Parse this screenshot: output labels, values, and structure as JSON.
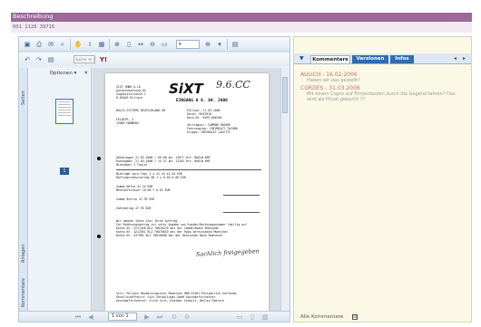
{
  "header": {
    "title": "Beschreibung",
    "id_text": "001 1120 39716"
  },
  "viewer": {
    "search_placeholder": "Suche im Web",
    "zoom": "▾",
    "sidebar": {
      "options_label": "Optionen ▾",
      "tabs": [
        "Seiten",
        "Anlagen",
        "Kommentare"
      ]
    },
    "thumbnail_page": "1",
    "status": {
      "page_box": "1 von 1"
    },
    "document": {
      "logo": "SiXT",
      "handwriting_top": "9.6.CC",
      "stamp": "EINGANG 0 6. 04. 2006",
      "address": [
        "SIXT GMBH & CO",
        "Autovermietung KG",
        "Zugspitzstrasse 1",
        "D-82049 Pullach"
      ],
      "recipient": [
        "BULIG-SYSTEMS DEUTSCHLAND GM",
        "FELDSTR. 3",
        "22085 HAMBURG"
      ],
      "meta_lines": [
        "Pullach,          21.03.2006",
        "Rechn. 9033918",
        "Rech-Nr.  9495-006706",
        "Vertragsnr:      COMMON INSURE",
        "Fahrzeugtyp:   CHEVROLET TACUMA",
        "Gruppe:          CHEVROLET LACETTI"
      ],
      "line_items": [
        "Abhoiungen  21.03.2006 / 09.00   km:  13077   Ort: BUELW KMF",
        "Rueckgabe:  21.03.2006 / 15.57   km:  13103   Ort: BUELW KMF",
        "Mietdauer    1 Tag(e)",
        "Mietlage       1pro Tag)         1 x          41.34        41.34   EUR",
        "Haftungsreduzierung  SB          1 x           0.00         0.00   EUR",
        "Summe Netto                                              41.34   EUR",
        "Mehrwertsteuer     16.00 %                                6.61   EUR",
        "Summe Brutto                                             47.95   EUR",
        "Zahlbetrag                                               47.95   EUR"
      ],
      "notes": [
        "Wir danken Ihnen fuer Ihren Auftrag.",
        "Zur Rechnungsbetrag ist unter Angabe von Kunden/Rechnungsnummer faellig auf",
        "Konto Nr.  3217440  BLZ 70020270  bei der Commerzbank Muenchen",
        "Konto Nr.  4212051  BLZ 70070010  bei der Hypo-Vereinsbank Muenchen",
        "Konto Nr.  437501   BLZ 70010080  bei der Deutschen Bank Muenchen"
      ],
      "signature": "Sachlich freigegeben",
      "footer_lines": [
        "Sitz: Pullach  Handelsregister Muenchen HRB 91501  Persoenlich haftende",
        "Gesellschafterin: Sixt Verwaltungs-GmbH  Geschaeftsfuehrer",
        "Geschaeftsfuehrer: Erich Sixt, Dietmar Schmitt, Detlev Paetsch"
      ]
    }
  },
  "comments_panel": {
    "tabs": [
      "Kommentare",
      "Versionen",
      "Infos"
    ],
    "comments": [
      {
        "author_date": "AULICH - 16.02.2006",
        "text": "Haben wir das bestellt?"
      },
      {
        "author_date": "CORDES - 31.03.2006",
        "text": "Mit einem Capro auf Firmenkosten durch die Gegend fahren? Das wird als Privat gebucht !!!"
      }
    ],
    "footer_label": "Alle Kommentare",
    "footer_checked": "☑"
  }
}
